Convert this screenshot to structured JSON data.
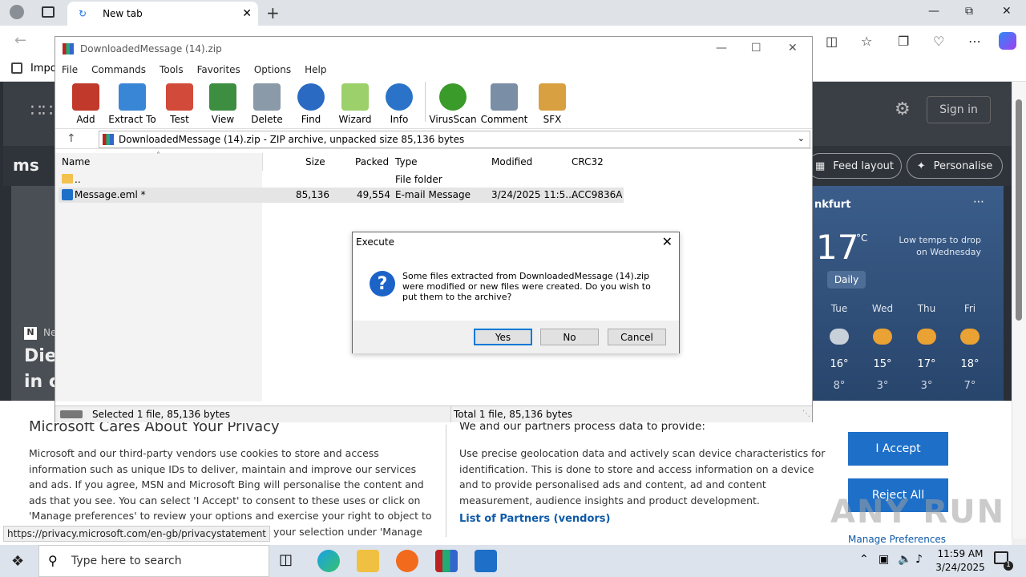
{
  "browser": {
    "tab_title": "New tab",
    "fav_item": "Impor"
  },
  "msn": {
    "signin": "Sign in",
    "feed_layout": "Feed layout",
    "personalise": "Personalise",
    "headline_prefix": "Die",
    "headline_line2": "in c",
    "source_prefix": "Ne",
    "weather": {
      "city": "nkfurt",
      "temp": "17",
      "unit": "°C",
      "note": "Low temps to drop on Wednesday",
      "tab": "Daily",
      "days": [
        {
          "day": "Tue",
          "hi": "16°",
          "lo": "8°"
        },
        {
          "day": "Wed",
          "hi": "15°",
          "lo": "3°"
        },
        {
          "day": "Thu",
          "hi": "17°",
          "lo": "3°"
        },
        {
          "day": "Fri",
          "hi": "18°",
          "lo": "7°"
        }
      ]
    }
  },
  "privacy": {
    "title": "Microsoft Cares About Your Privacy",
    "text": "Microsoft and our third-party vendors use cookies to store and access information such as unique IDs to deliver, maintain and improve our services and ads. If you agree, MSN and Microsoft Bing will personalise the content and ads that you see. You can select 'I Accept' to consent to these uses or click on 'Manage preferences' to review your options and exercise your right to object to Legitimate Interest where used. You can change your selection under 'Manage Preferences' at the bottom of",
    "right_title": "We and our partners process data to provide:",
    "right_text": "Use precise geolocation data and actively scan device characteristics for identification. This is done to store and access information on a device and to provide personalised ads and content, ad and content measurement, audience insights and product development.",
    "partners": "List of Partners (vendors)",
    "accept": "I Accept",
    "reject": "Reject All",
    "manage": "Manage Preferences",
    "status_url": "https://privacy.microsoft.com/en-gb/privacystatement"
  },
  "watermark": "ANY RUN",
  "winrar": {
    "title": "DownloadedMessage (14).zip",
    "menu": [
      "File",
      "Commands",
      "Tools",
      "Favorites",
      "Options",
      "Help"
    ],
    "tools": [
      {
        "label": "Add",
        "color": "#c0392b"
      },
      {
        "label": "Extract To",
        "color": "#3a86d6"
      },
      {
        "label": "Test",
        "color": "#d24a3a"
      },
      {
        "label": "View",
        "color": "#3e8e41"
      },
      {
        "label": "Delete",
        "color": "#8a9aa8"
      },
      {
        "label": "Find",
        "color": "#2a6ac2"
      },
      {
        "label": "Wizard",
        "color": "#9bd06a"
      },
      {
        "label": "Info",
        "color": "#2a73c8"
      },
      {
        "label": "VirusScan",
        "color": "#3a9a2a"
      },
      {
        "label": "Comment",
        "color": "#7a8ea6"
      },
      {
        "label": "SFX",
        "color": "#d8a040"
      }
    ],
    "path": "DownloadedMessage (14).zip - ZIP archive, unpacked size 85,136 bytes",
    "columns": [
      "Name",
      "Size",
      "Packed",
      "Type",
      "Modified",
      "CRC32"
    ],
    "rows": [
      {
        "name": "..",
        "size": "",
        "packed": "",
        "type": "File folder",
        "modified": "",
        "crc": ""
      },
      {
        "name": "Message.eml *",
        "size": "85,136",
        "packed": "49,554",
        "type": "E-mail Message",
        "modified": "3/24/2025 11:5...",
        "crc": "ACC9836A"
      }
    ],
    "status_left": "Selected 1 file, 85,136 bytes",
    "status_right": "Total 1 file, 85,136 bytes"
  },
  "dialog": {
    "title": "Execute",
    "message": "Some files extracted from DownloadedMessage (14).zip were modified or new files were created. Do you wish to put them to the archive?",
    "yes": "Yes",
    "no": "No",
    "cancel": "Cancel"
  },
  "taskbar": {
    "search_placeholder": "Type here to search",
    "time": "11:59 AM",
    "date": "3/24/2025",
    "notif_count": "1"
  }
}
